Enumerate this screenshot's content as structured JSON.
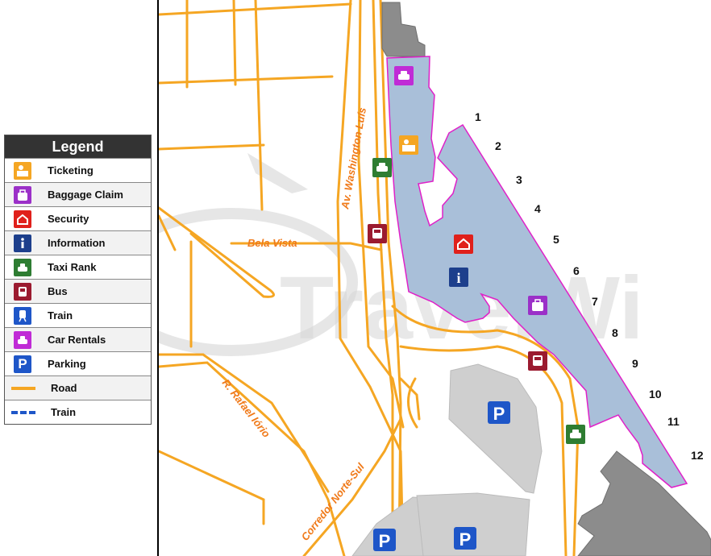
{
  "legend": {
    "title": "Legend",
    "items": [
      {
        "label": "Ticketing",
        "icon": "ticketing-icon",
        "color": "#f5a623"
      },
      {
        "label": "Baggage Claim",
        "icon": "baggage-claim-icon",
        "color": "#9b30c8"
      },
      {
        "label": "Security",
        "icon": "security-icon",
        "color": "#e0201b"
      },
      {
        "label": "Information",
        "icon": "information-icon",
        "color": "#1d3f8c"
      },
      {
        "label": "Taxi Rank",
        "icon": "taxi-icon",
        "color": "#2e7d32"
      },
      {
        "label": "Bus",
        "icon": "bus-icon",
        "color": "#9b1b30"
      },
      {
        "label": "Train",
        "icon": "train-icon",
        "color": "#1e56c8"
      },
      {
        "label": "Car Rentals",
        "icon": "car-rental-icon",
        "color": "#c02bd6"
      },
      {
        "label": "Parking",
        "icon": "parking-icon",
        "color": "#1e56c8"
      },
      {
        "label": "Road",
        "icon": "road-line-icon",
        "color": "#f5a623"
      },
      {
        "label": "Train",
        "icon": "train-line-icon",
        "color": "#1e56c8"
      }
    ]
  },
  "roads": {
    "washington_luis": "Av. Washington Luís",
    "bela_vista": "Bela Vista",
    "rafael_iorio": "R. Rafael Iório",
    "corredor": "Corredor Norte-Sul"
  },
  "gates": [
    "1",
    "2",
    "3",
    "4",
    "5",
    "6",
    "7",
    "8",
    "9",
    "10",
    "11",
    "12"
  ],
  "watermark": "TravelWi",
  "parking_symbol": "P",
  "info_symbol": "i",
  "colors": {
    "road": "#f5a623",
    "terminal_fill": "#a9bfd9",
    "terminal_outline": "#e020c8",
    "building": "#8c8c8c",
    "parking_lot": "#cfcfcf"
  }
}
